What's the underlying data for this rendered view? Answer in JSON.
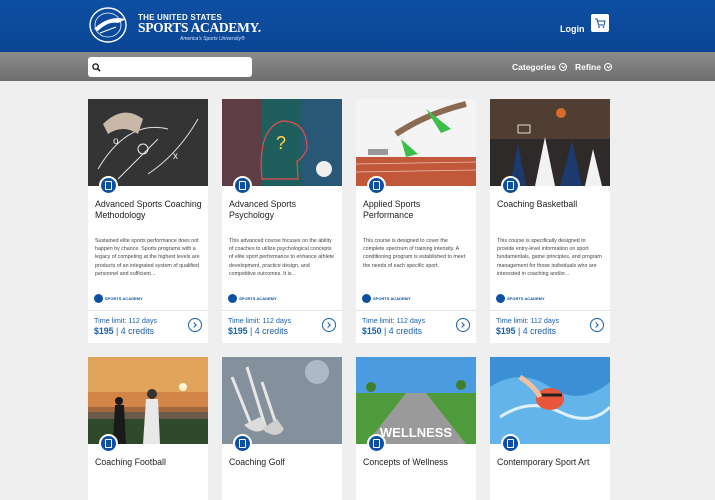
{
  "header": {
    "brand_line1": "THE UNITED STATES",
    "brand_line2": "SPORTS ACADEMY.",
    "tagline": "America's Sports University®",
    "login_label": "Login"
  },
  "filters": {
    "search_placeholder": "",
    "categories_label": "Categories",
    "refine_label": "Refine"
  },
  "colors": {
    "brand_blue": "#0d4fa3",
    "link_blue": "#1a5fa8",
    "bar_gray": "#7d7d7d"
  },
  "courses": [
    {
      "title": "Advanced Sports Coaching Methodology",
      "description": "Sustained elite sports performance does not happen by chance. Sports programs with a legacy of competing at the highest levels are products of an integrated system of qualified personnel and sufficient...",
      "time": "Time limit: 112 days",
      "price": "$195",
      "credits": " | 4 credits"
    },
    {
      "title": "Advanced Sports Psychology",
      "description": "This advanced course focuses on the ability of coaches to utilize psychological concepts of elite sport performance to enhance athlete development, practice design, and competitive outcomes. It is...",
      "time": "Time limit: 112 days",
      "price": "$195",
      "credits": " | 4 credits"
    },
    {
      "title": "Applied Sports Performance",
      "description": "This course is designed to cover the complete spectrum of training intensity. A conditioning program is established to meet the needs of each specific sport.",
      "time": "Time limit: 112 days",
      "price": "$150",
      "credits": " | 4 credits"
    },
    {
      "title": "Coaching Basketball",
      "description": "This course is specifically designed to provide entry-level information on sport fundamentals, game principles, and program management for those individuals who are interested in coaching and/or...",
      "time": "Time limit: 112 days",
      "price": "$195",
      "credits": " | 4 credits"
    },
    {
      "title": "Coaching Football"
    },
    {
      "title": "Coaching Golf"
    },
    {
      "title": "Concepts of Wellness",
      "image_text": "WELLNESS"
    },
    {
      "title": "Contemporary Sport Art"
    }
  ],
  "minilogo_text": "SPORTS ACADEMY"
}
